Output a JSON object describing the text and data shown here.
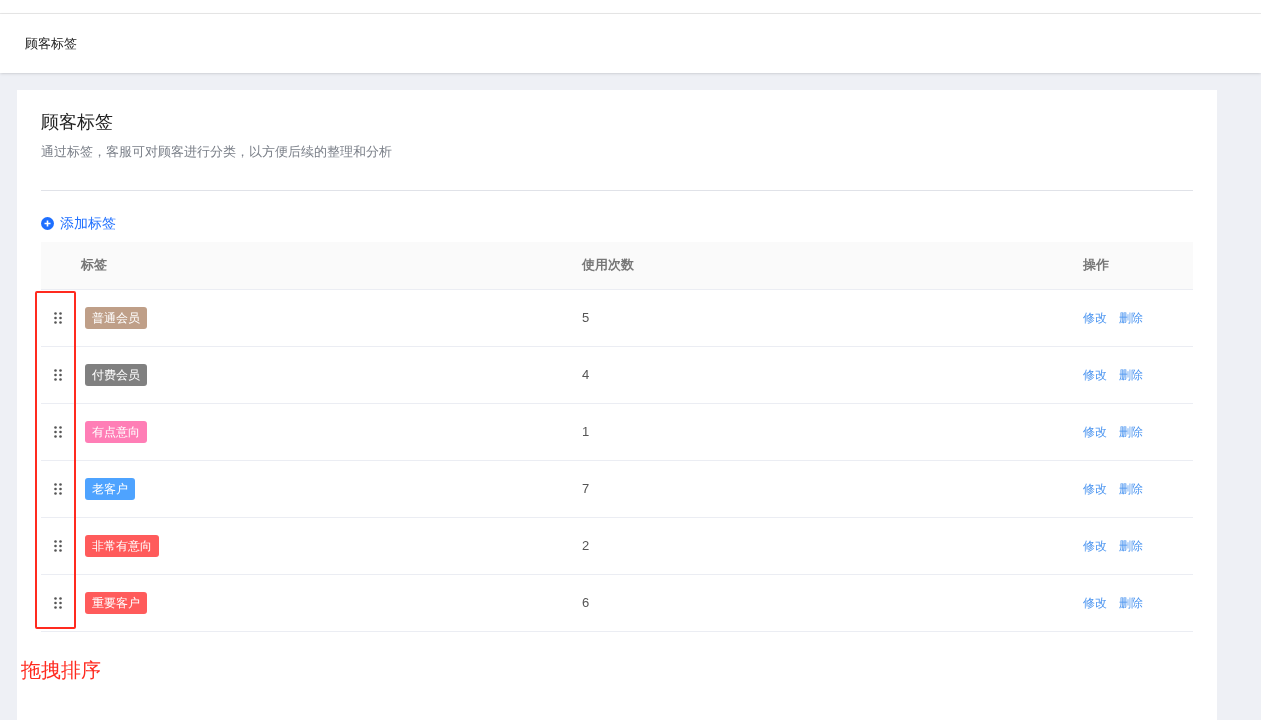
{
  "header": {
    "title": "顾客标签"
  },
  "card": {
    "title": "顾客标签",
    "description": "通过标签，客服可对顾客进行分类，以方便后续的整理和分析",
    "add_link": "添加标签"
  },
  "table": {
    "columns": [
      "标签",
      "使用次数",
      "操作"
    ],
    "rows": [
      {
        "tag": "普通会员",
        "color": "#bf9f88",
        "count": "5",
        "actions": [
          "修改",
          "删除"
        ]
      },
      {
        "tag": "付费会员",
        "color": "#808080",
        "count": "4",
        "actions": [
          "修改",
          "删除"
        ]
      },
      {
        "tag": "有点意向",
        "color": "#ff7eb6",
        "count": "1",
        "actions": [
          "修改",
          "删除"
        ]
      },
      {
        "tag": "老客户",
        "color": "#4ea3ff",
        "count": "7",
        "actions": [
          "修改",
          "删除"
        ]
      },
      {
        "tag": "非常有意向",
        "color": "#ff5b5b",
        "count": "2",
        "actions": [
          "修改",
          "删除"
        ]
      },
      {
        "tag": "重要客户",
        "color": "#ff5b5b",
        "count": "6",
        "actions": [
          "修改",
          "删除"
        ]
      }
    ]
  },
  "annotation": {
    "text": "拖拽排序"
  }
}
